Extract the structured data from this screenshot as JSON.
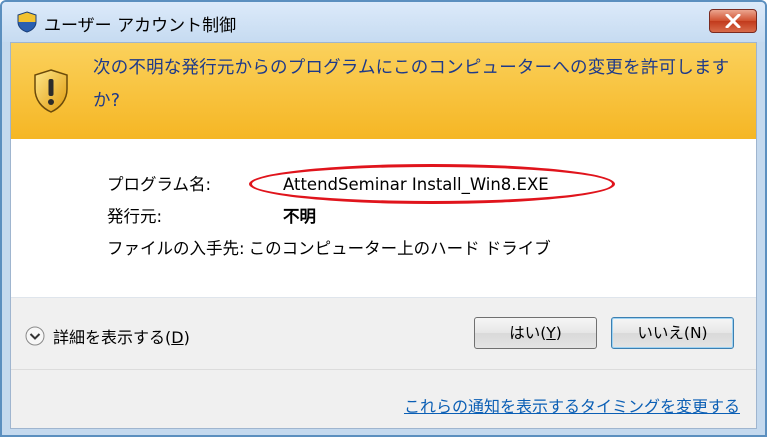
{
  "window": {
    "title": "ユーザー アカウント制御"
  },
  "banner": {
    "message": "次の不明な発行元からのプログラムにこのコンピューターへの変更を許可しますか?"
  },
  "info": {
    "program_label": "プログラム名:",
    "program_value": "AttendSeminar Install_Win8.EXE",
    "publisher_label": "発行元:",
    "publisher_value": "不明",
    "origin_label": "ファイルの入手先:",
    "origin_value": "このコンピューター上のハード ドライブ"
  },
  "footer": {
    "details_label_pre": "詳細を表示する(",
    "details_access_key": "D",
    "details_label_post": ")",
    "yes_label_pre": "はい(",
    "yes_access_key": "Y",
    "yes_label_post": ")",
    "no_label": "いいえ(N)",
    "settings_link": "これらの通知を表示するタイミングを変更する"
  },
  "icons": {
    "title_icon": "uac-shield-icon",
    "banner_icon": "warning-shield-icon",
    "details_icon": "chevron-down-circle-icon",
    "close_icon": "close-icon"
  },
  "colors": {
    "banner_top": "#fbd15c",
    "banner_bottom": "#f5b624",
    "banner_text": "#1e3a8a",
    "highlight_ellipse": "#e0141c",
    "link": "#0b5fb5",
    "close_button": "#d0502f"
  }
}
